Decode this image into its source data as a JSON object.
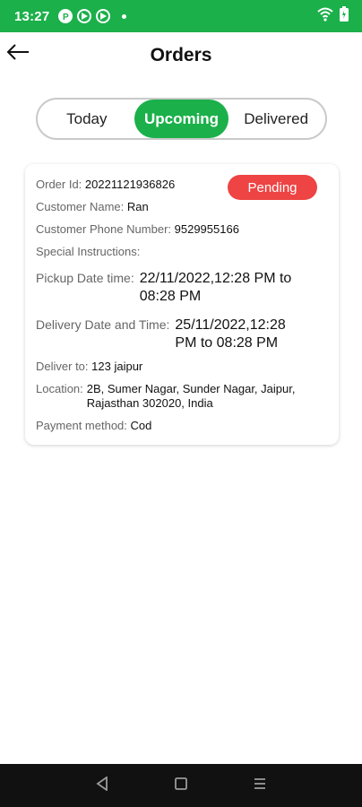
{
  "status_bar": {
    "time": "13:27",
    "left_icons": [
      "p-badge-icon",
      "play-circle-icon",
      "play-circle-icon",
      "dot-icon"
    ],
    "right_icons": [
      "wifi-icon",
      "battery-icon"
    ],
    "color": "#1bb04a"
  },
  "header": {
    "title": "Orders",
    "back_icon": "arrow-left-icon"
  },
  "tabs": [
    {
      "label": "Today",
      "active": false
    },
    {
      "label": "Upcoming",
      "active": true
    },
    {
      "label": "Delivered",
      "active": false
    }
  ],
  "order": {
    "order_id_label": "Order Id:",
    "order_id": "20221121936826",
    "status": "Pending",
    "customer_name_label": "Customer  Name:",
    "customer_name": "Ran",
    "phone_label": "Customer Phone Number:",
    "phone": "9529955166",
    "special_label": "Special Instructions:",
    "special": "",
    "pickup_label": "Pickup Date time:",
    "pickup_line1": "22/11/2022,12:28 PM to",
    "pickup_line2": "08:28 PM",
    "delivery_label": "Delivery Date and Time:",
    "delivery_line1": "25/11/2022,12:28",
    "delivery_line2": "PM to 08:28 PM",
    "deliver_to_label": "Deliver to:",
    "deliver_to": "123 jaipur",
    "location_label": "Location:",
    "location_line1": "2B, Sumer Nagar, Sunder Nagar, Jaipur,",
    "location_line2": "Rajasthan 302020, India",
    "payment_label": "Payment method:",
    "payment": "Cod"
  },
  "colors": {
    "accent": "#1bb04a",
    "pending": "#ee4444"
  },
  "nav_bar": {
    "icons": [
      "back-triangle-icon",
      "home-square-icon",
      "recents-menu-icon"
    ]
  }
}
